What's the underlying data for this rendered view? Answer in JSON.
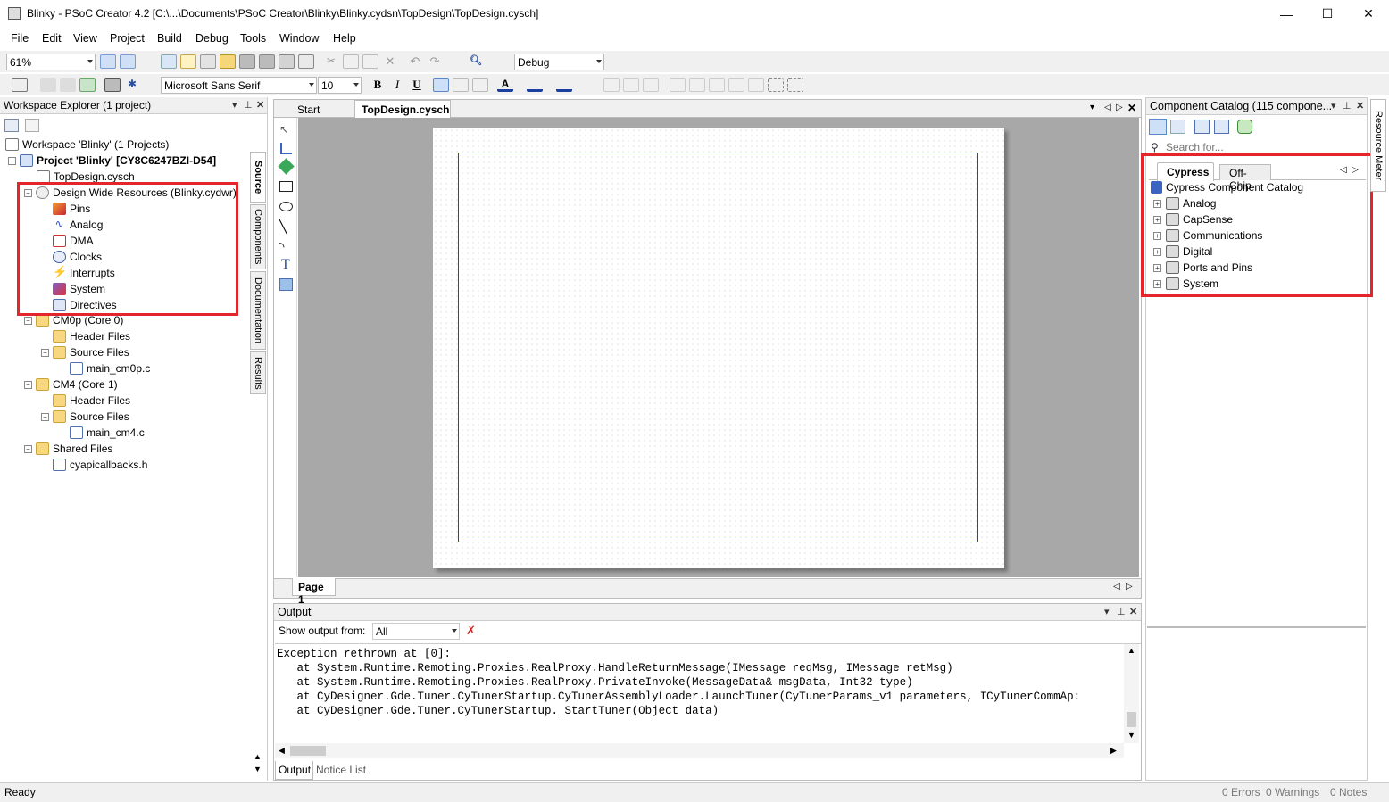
{
  "window": {
    "title": "Blinky - PSoC Creator 4.2  [C:\\...\\Documents\\PSoC Creator\\Blinky\\Blinky.cydsn\\TopDesign\\TopDesign.cysch]",
    "minimize": "—",
    "maximize": "☐",
    "close": "✕"
  },
  "menu": [
    "File",
    "Edit",
    "View",
    "Project",
    "Build",
    "Debug",
    "Tools",
    "Window",
    "Help"
  ],
  "toolbar": {
    "zoom": "61%",
    "build_config": "Debug",
    "font_name": "Microsoft Sans Serif",
    "font_size": "10",
    "bold": "B",
    "italic": "I",
    "underline": "U",
    "text_color": "A"
  },
  "workspace": {
    "header": "Workspace Explorer (1 project)",
    "items": [
      {
        "label": "Workspace 'Blinky' (1 Projects)",
        "icon": "workspace-icon"
      },
      {
        "label": "Project  'Blinky' [CY8C6247BZI-D54]",
        "icon": "project-icon"
      },
      {
        "label": "TopDesign.cysch",
        "icon": "schematic-icon"
      },
      {
        "label": "Design Wide Resources (Blinky.cydwr)",
        "icon": "dwr-icon"
      },
      {
        "label": "Pins",
        "icon": "pins-icon"
      },
      {
        "label": "Analog",
        "icon": "analog-icon"
      },
      {
        "label": "DMA",
        "icon": "dma-icon"
      },
      {
        "label": "Clocks",
        "icon": "clock-icon"
      },
      {
        "label": "Interrupts",
        "icon": "interrupt-icon"
      },
      {
        "label": "System",
        "icon": "system-icon"
      },
      {
        "label": "Directives",
        "icon": "directives-icon"
      },
      {
        "label": "CM0p (Core 0)",
        "icon": "folder-icon"
      },
      {
        "label": "Header Files",
        "icon": "folder-icon"
      },
      {
        "label": "Source Files",
        "icon": "folder-icon"
      },
      {
        "label": "main_cm0p.c",
        "icon": "c-file-icon"
      },
      {
        "label": "CM4 (Core 1)",
        "icon": "folder-icon"
      },
      {
        "label": "Header Files",
        "icon": "folder-icon"
      },
      {
        "label": "Source Files",
        "icon": "folder-icon"
      },
      {
        "label": "main_cm4.c",
        "icon": "c-file-icon"
      },
      {
        "label": "Shared Files",
        "icon": "folder-icon"
      },
      {
        "label": "cyapicallbacks.h",
        "icon": "h-file-icon"
      }
    ],
    "side_tabs": [
      "Source",
      "Components",
      "Documentation",
      "Results"
    ]
  },
  "editor": {
    "tabs": [
      "Start Page",
      "TopDesign.cysch"
    ],
    "page_tab": "Page 1",
    "tools": [
      "pointer-icon",
      "wire-icon",
      "component-icon",
      "rectangle-icon",
      "ellipse-icon",
      "line-icon",
      "arc-icon",
      "text-tool-icon",
      "image-tool-icon"
    ]
  },
  "output": {
    "header": "Output",
    "show_label": "Show output from:",
    "source": "All",
    "lines": [
      "Exception rethrown at [0]:",
      "   at System.Runtime.Remoting.Proxies.RealProxy.HandleReturnMessage(IMessage reqMsg, IMessage retMsg)",
      "   at System.Runtime.Remoting.Proxies.RealProxy.PrivateInvoke(MessageData& msgData, Int32 type)",
      "   at CyDesigner.Gde.Tuner.CyTunerStartup.CyTunerAssemblyLoader.LaunchTuner(CyTunerParams_v1 parameters, ICyTunerCommAp:",
      "   at CyDesigner.Gde.Tuner.CyTunerStartup._StartTuner(Object data)"
    ],
    "tabs": [
      "Output",
      "Notice List"
    ]
  },
  "catalog": {
    "header": "Component Catalog (115 compone...",
    "search_placeholder": "Search for...",
    "tabs": [
      "Cypress",
      "Off-Chip"
    ],
    "root": "Cypress Component Catalog",
    "items": [
      "Analog",
      "CapSense",
      "Communications",
      "Digital",
      "Ports and Pins",
      "System"
    ],
    "side_tab": "Resource Meter"
  },
  "status": {
    "left": "Ready",
    "errors": "0 Errors",
    "warnings": "0 Warnings",
    "notes": "0 Notes"
  },
  "colors": {
    "highlight_box": "#e3262b",
    "accent_blue": "#3b63c2"
  }
}
